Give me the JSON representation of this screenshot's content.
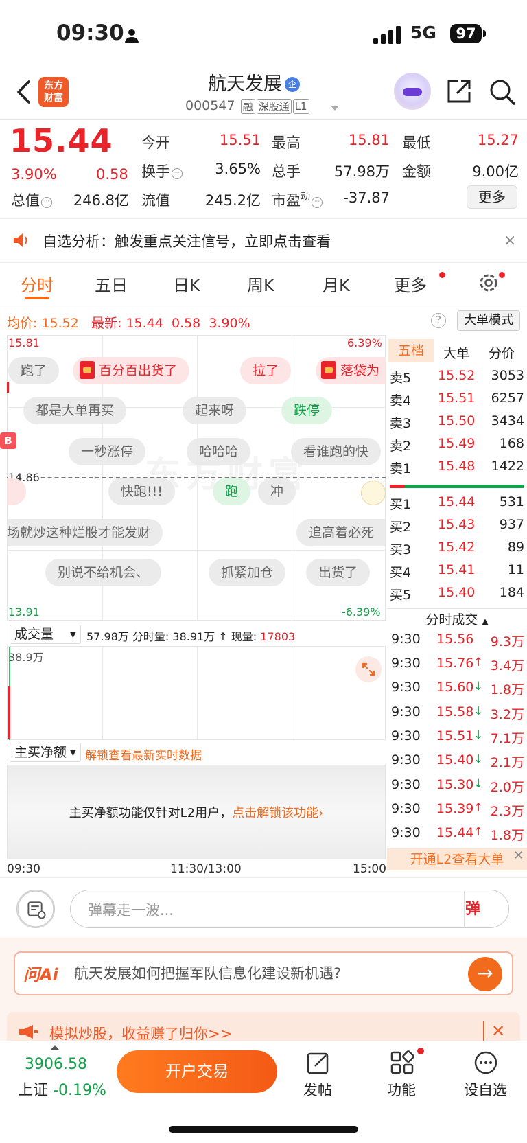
{
  "status": {
    "time": "09:30",
    "network": "5G",
    "battery": "97"
  },
  "header": {
    "logo": [
      "东方",
      "财富"
    ],
    "stock_name": "航天发展",
    "zq_badge": "企",
    "code": "000547",
    "tags": [
      "融",
      "深股通",
      "L1"
    ]
  },
  "quote": {
    "price": "15.44",
    "pct": "3.90%",
    "change": "0.58",
    "open_label": "今开",
    "open": "15.51",
    "high_label": "最高",
    "high": "15.81",
    "low_label": "最低",
    "low": "15.27",
    "turnover_label": "换手",
    "turnover": "3.65%",
    "volume_label": "总手",
    "volume": "57.98万",
    "amount_label": "金额",
    "amount": "9.00亿",
    "mktcap_label": "总值",
    "mktcap": "246.8亿",
    "float_label": "流值",
    "float": "245.2亿",
    "pe_label": "市盈",
    "pe_sup": "动",
    "pe": "-37.87",
    "more_label": "更多"
  },
  "notice": {
    "text": "自选分析：触发重点关注信号，立即点击查看",
    "close": "×"
  },
  "tabs": [
    "分时",
    "五日",
    "日K",
    "周K",
    "月K",
    "更多"
  ],
  "priceline": {
    "avg_label": "均价:",
    "avg": "15.52",
    "latest_label": "最新:",
    "latest": "15.44",
    "chg": "0.58",
    "pct": "3.90%",
    "help": "?",
    "big_mode": "大单模式"
  },
  "chart": {
    "y_top": "15.81",
    "y_mid": "14.86",
    "y_bottom": "13.91",
    "pct_top": "6.39%",
    "pct_bottom": "-6.39%",
    "b_marker": "B",
    "danmaku": [
      "跑了",
      "百分百出货了",
      "拉了",
      "落袋为",
      "都是大单再买",
      "起来呀",
      "跌停",
      "一秒涨停",
      "哈哈哈",
      "看谁跑的快",
      "快跑!!!",
      "跑",
      "冲",
      "场就炒这种烂股才能发财",
      "追高着必死",
      "别说不给机会、",
      "抓紧加仓",
      "出货了"
    ],
    "watermark": "东方财富"
  },
  "volume": {
    "select": "成交量",
    "total": "57.98万",
    "period_label": "分时量:",
    "period": "38.91万",
    "now_label": "现量:",
    "now": "17803",
    "max": "38.9万"
  },
  "netbuy": {
    "select": "主买净额",
    "unlock": "解锁查看最新实时数据",
    "msg": "主买净额功能仅针对L2用户，",
    "msg_link": "点击解锁该功能"
  },
  "time_axis": [
    "09:30",
    "11:30/13:00",
    "15:00"
  ],
  "right_tabs": [
    "五档",
    "大单",
    "分价"
  ],
  "asks": [
    {
      "label": "卖5",
      "price": "15.52",
      "vol": "3053"
    },
    {
      "label": "卖4",
      "price": "15.51",
      "vol": "6257"
    },
    {
      "label": "卖3",
      "price": "15.50",
      "vol": "3434"
    },
    {
      "label": "卖2",
      "price": "15.49",
      "vol": "168"
    },
    {
      "label": "卖1",
      "price": "15.48",
      "vol": "1422"
    }
  ],
  "bids": [
    {
      "label": "买1",
      "price": "15.44",
      "vol": "531"
    },
    {
      "label": "买2",
      "price": "15.43",
      "vol": "937"
    },
    {
      "label": "买3",
      "price": "15.42",
      "vol": "89"
    },
    {
      "label": "买4",
      "price": "15.41",
      "vol": "11"
    },
    {
      "label": "买5",
      "price": "15.40",
      "vol": "184"
    }
  ],
  "ticks_header": "分时成交",
  "ticks": [
    {
      "t": "9:30",
      "p": "15.56",
      "a": "",
      "v": "9.3万"
    },
    {
      "t": "9:30",
      "p": "15.76",
      "a": "↑",
      "v": "3.4万"
    },
    {
      "t": "9:30",
      "p": "15.60",
      "a": "↓",
      "v": "1.8万"
    },
    {
      "t": "9:30",
      "p": "15.58",
      "a": "↓",
      "v": "3.2万"
    },
    {
      "t": "9:30",
      "p": "15.51",
      "a": "↓",
      "v": "7.1万"
    },
    {
      "t": "9:30",
      "p": "15.40",
      "a": "↓",
      "v": "2.1万"
    },
    {
      "t": "9:30",
      "p": "15.30",
      "a": "↓",
      "v": "2.0万"
    },
    {
      "t": "9:30",
      "p": "15.39",
      "a": "↑",
      "v": "2.3万"
    },
    {
      "t": "9:30",
      "p": "15.44",
      "a": "↑",
      "v": "1.8万"
    }
  ],
  "l2_banner": "开通L2查看大单",
  "danmaku_input": {
    "placeholder": "弹幕走一波...",
    "send": "弹"
  },
  "ai": {
    "logo": "问Ai",
    "question": "航天发展如何把握军队信息化建设新机遇?"
  },
  "sim": {
    "text": "模拟炒股，收益赚了归你>>"
  },
  "bottom": {
    "index_value": "3906.58",
    "index_name": "上证",
    "index_pct": "-0.19%",
    "trade": "开户交易",
    "post": "发帖",
    "func": "功能",
    "watch": "设自选"
  },
  "colors": {
    "up": "#e8232a",
    "down": "#12a24a",
    "accent": "#f26b1d"
  }
}
